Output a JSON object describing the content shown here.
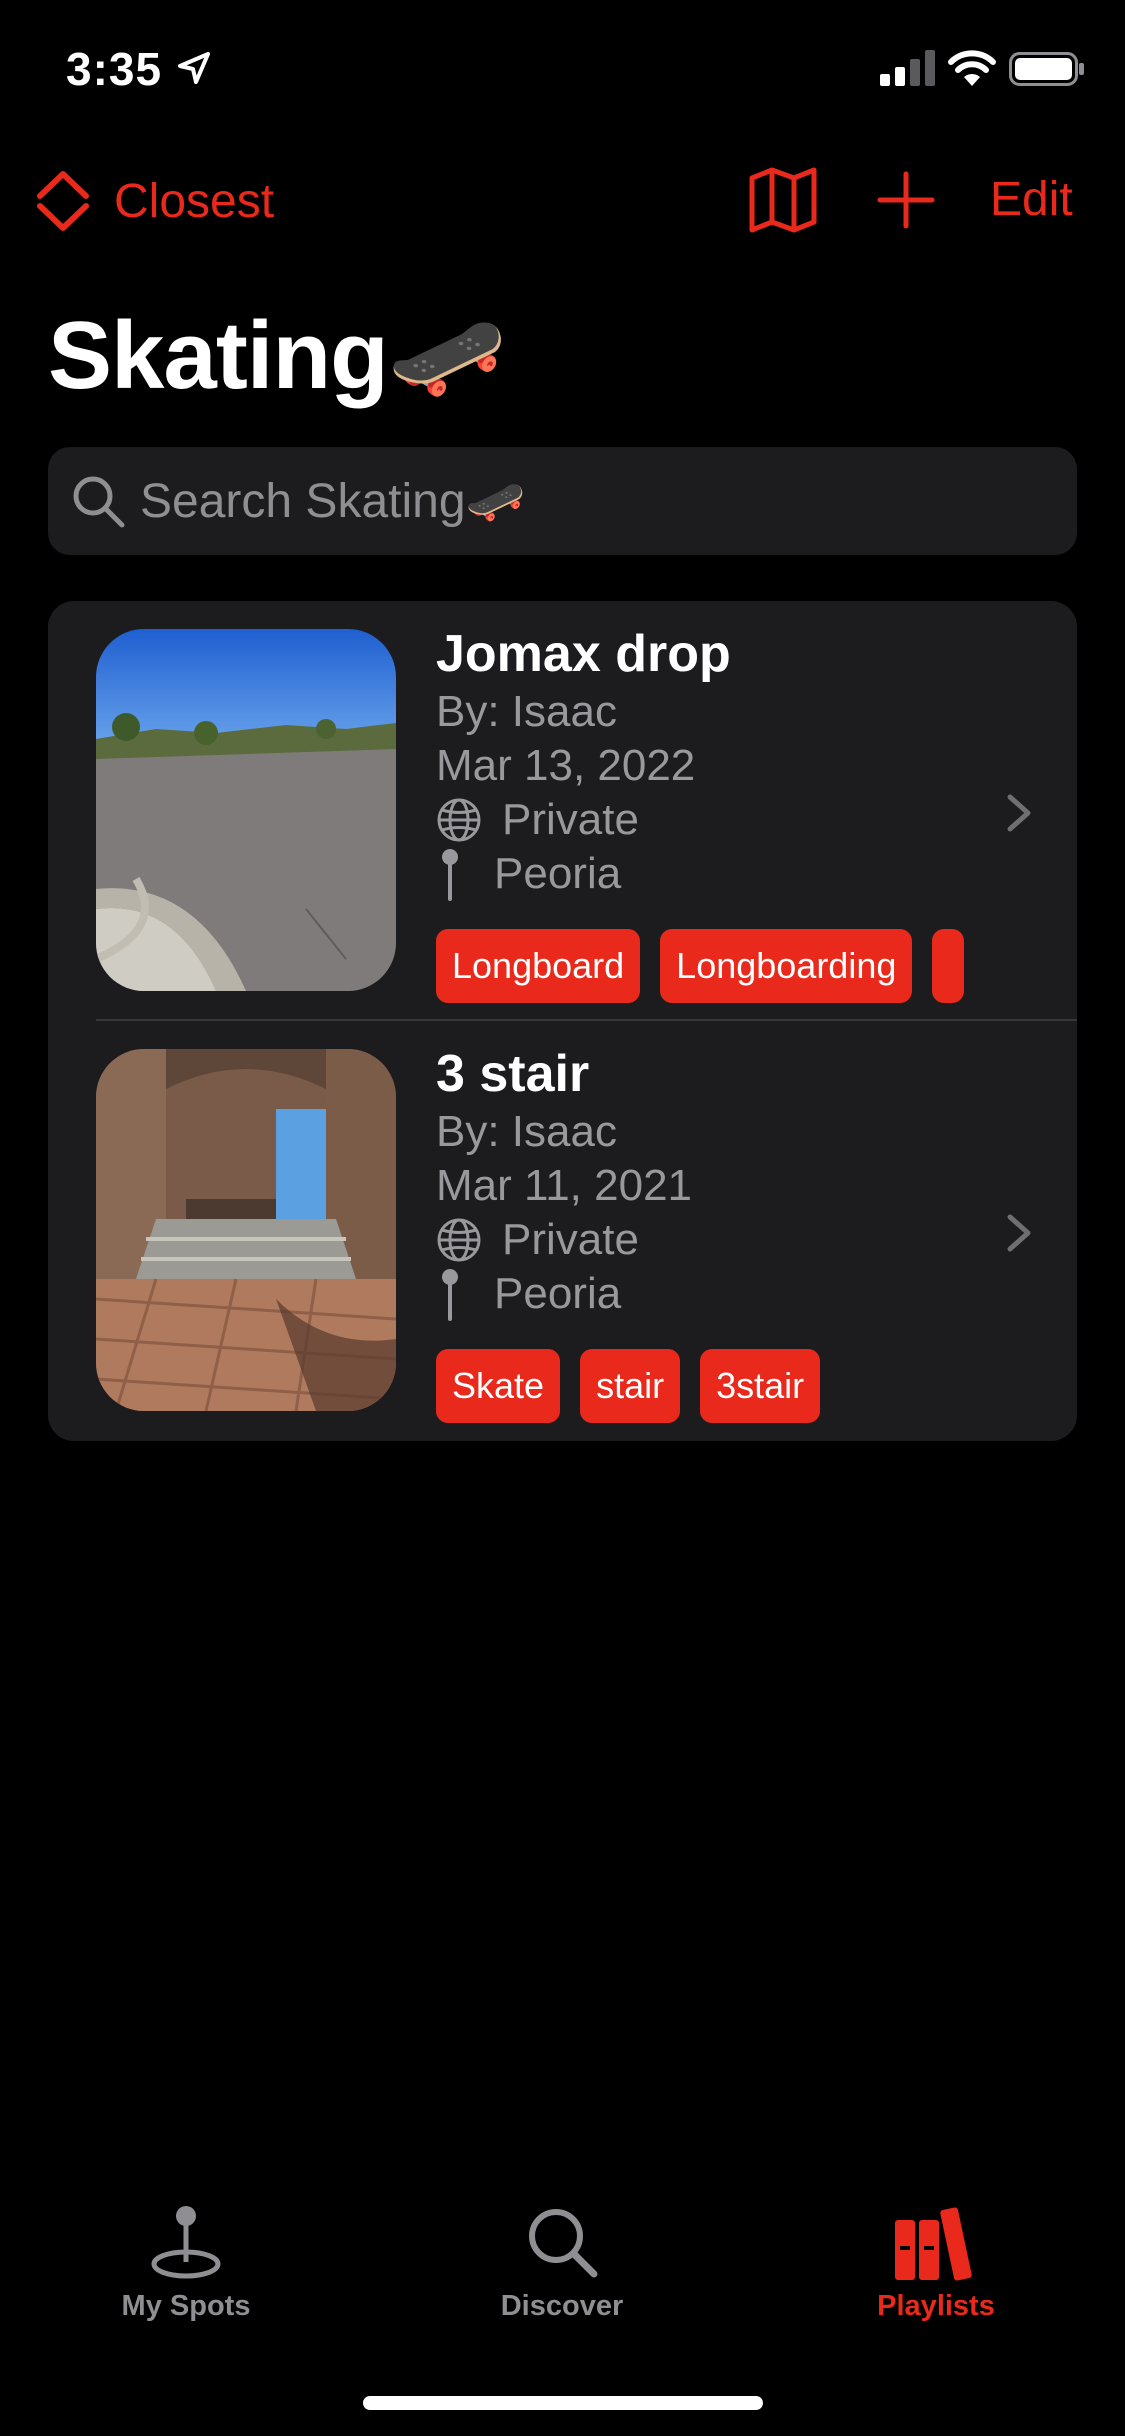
{
  "status_bar": {
    "time": "3:35"
  },
  "nav": {
    "sort_label": "Closest",
    "edit_label": "Edit"
  },
  "page": {
    "title": "Skating🛹"
  },
  "search": {
    "placeholder": "Search Skating🛹"
  },
  "spots": [
    {
      "title": "Jomax drop",
      "author": "By: Isaac",
      "date": "Mar 13, 2022",
      "privacy": "Private",
      "location": "Peoria",
      "tags": [
        "Longboard",
        "Longboarding"
      ]
    },
    {
      "title": "3 stair",
      "author": "By: Isaac",
      "date": "Mar 11, 2021",
      "privacy": "Private",
      "location": "Peoria",
      "tags": [
        "Skate",
        "stair",
        "3stair"
      ]
    }
  ],
  "tabs": [
    {
      "label": "My Spots"
    },
    {
      "label": "Discover"
    },
    {
      "label": "Playlists",
      "selected": true
    }
  ],
  "colors": {
    "accent": "#e8291c",
    "background": "#000000",
    "card": "#1c1c1e",
    "secondary_text": "#98989d"
  }
}
